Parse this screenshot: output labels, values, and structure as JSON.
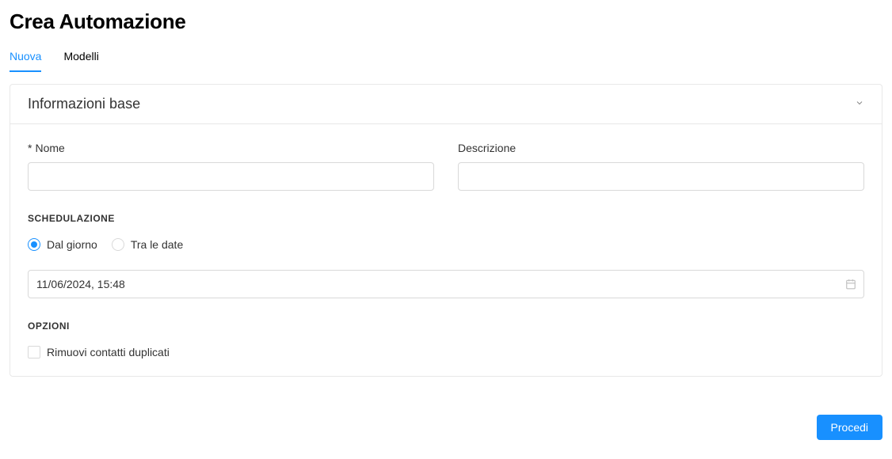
{
  "header": {
    "title": "Crea Automazione"
  },
  "tabs": [
    {
      "label": "Nuova",
      "active": true
    },
    {
      "label": "Modelli",
      "active": false
    }
  ],
  "panel": {
    "title": "Informazioni base"
  },
  "form": {
    "name": {
      "label": "Nome",
      "required": true,
      "value": ""
    },
    "description": {
      "label": "Descrizione",
      "value": ""
    }
  },
  "scheduling": {
    "section_label": "SCHEDULAZIONE",
    "radios": [
      {
        "label": "Dal giorno",
        "checked": true
      },
      {
        "label": "Tra le date",
        "checked": false
      }
    ],
    "date_value": "11/06/2024, 15:48"
  },
  "options": {
    "section_label": "OPZIONI",
    "remove_duplicates_label": "Rimuovi contatti duplicati"
  },
  "footer": {
    "proceed_label": "Procedi"
  }
}
